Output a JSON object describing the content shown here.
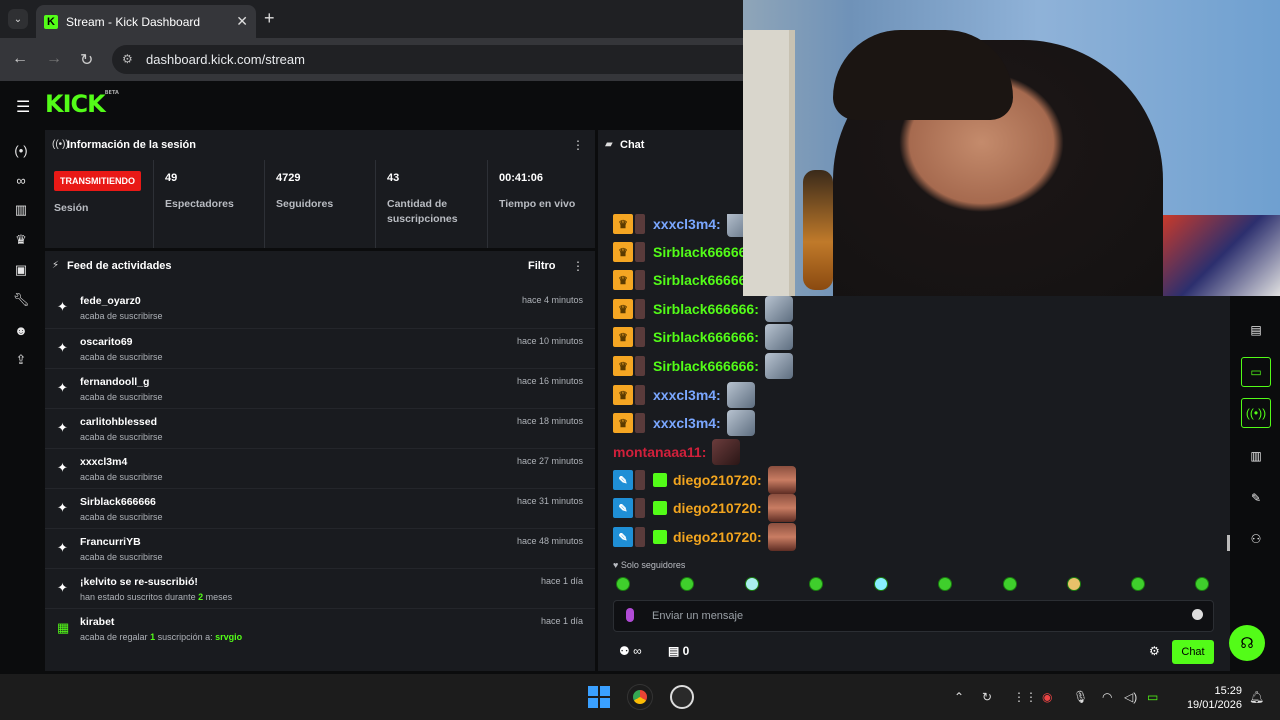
{
  "browser": {
    "tab_title": "Stream - Kick Dashboard",
    "url": "dashboard.kick.com/stream"
  },
  "kick": {
    "logo": "KICK",
    "logo_tag": "BETA"
  },
  "session": {
    "title": "Información de la sesión",
    "live_badge": "TRANSMITIENDO",
    "session_label": "Sesión",
    "stats": [
      {
        "value": "49",
        "label": "Espectadores"
      },
      {
        "value": "4729",
        "label": "Seguidores"
      },
      {
        "value": "43",
        "label": "Cantidad de suscripciones"
      },
      {
        "value": "00:41:06",
        "label": "Tiempo en vivo"
      }
    ]
  },
  "feed": {
    "title": "Feed de actividades",
    "filter": "Filtro",
    "items": [
      {
        "user": "fede_oyarz0",
        "sub": "acaba de suscribirse",
        "time": "hace 4 minutos"
      },
      {
        "user": "oscarito69",
        "sub": "acaba de suscribirse",
        "time": "hace 10 minutos"
      },
      {
        "user": "fernandooll_g",
        "sub": "acaba de suscribirse",
        "time": "hace 16 minutos"
      },
      {
        "user": "carlitohblessed",
        "sub": "acaba de suscribirse",
        "time": "hace 18 minutos"
      },
      {
        "user": "xxxcl3m4",
        "sub": "acaba de suscribirse",
        "time": "hace 27 minutos"
      },
      {
        "user": "Sirblack666666",
        "sub": "acaba de suscribirse",
        "time": "hace 31 minutos"
      },
      {
        "user": "FrancurriYB",
        "sub": "acaba de suscribirse",
        "time": "hace 48 minutos"
      },
      {
        "user": "¡kelvito se re-suscribió!",
        "sub_a": "han estado suscritos durante ",
        "sub_n": "2",
        "sub_b": " meses",
        "time": "hace 1 día"
      },
      {
        "user": "kirabet",
        "sub_a": "acaba de regalar ",
        "sub_n": "1",
        "sub_b": " suscripción a: ",
        "sub_c": "srvgio",
        "time": "hace 1 día"
      }
    ]
  },
  "chat": {
    "title": "Chat",
    "messages": [
      {
        "user": "xxxcl3m4:",
        "color": "#7aa7ff",
        "badge": "crown"
      },
      {
        "user": "Sirblack666666:",
        "color": "#53fc18",
        "badge": "crown"
      },
      {
        "user": "Sirblack666666:",
        "color": "#53fc18",
        "badge": "crown"
      },
      {
        "user": "Sirblack666666:",
        "color": "#53fc18",
        "badge": "crown"
      },
      {
        "user": "Sirblack666666:",
        "color": "#53fc18",
        "badge": "crown"
      },
      {
        "user": "Sirblack666666:",
        "color": "#53fc18",
        "badge": "crown"
      },
      {
        "user": "xxxcl3m4:",
        "color": "#7aa7ff",
        "badge": "crown"
      },
      {
        "user": "xxxcl3m4:",
        "color": "#7aa7ff",
        "badge": "crown"
      },
      {
        "user": "montanaaa11:",
        "color": "#d1203b",
        "badge": "none"
      },
      {
        "user": "diego210720:",
        "color": "#f2a51f",
        "badge": "mod"
      },
      {
        "user": "diego210720:",
        "color": "#f2a51f",
        "badge": "mod"
      },
      {
        "user": "diego210720:",
        "color": "#f2a51f",
        "badge": "mod"
      }
    ],
    "followers_only": "Solo seguidores",
    "input_placeholder": "Enviar un mensaje",
    "viewers_label": "∞",
    "points": "0",
    "send_button": "Chat"
  },
  "taskbar": {
    "time": "15:29",
    "date": "19/01/2026"
  }
}
